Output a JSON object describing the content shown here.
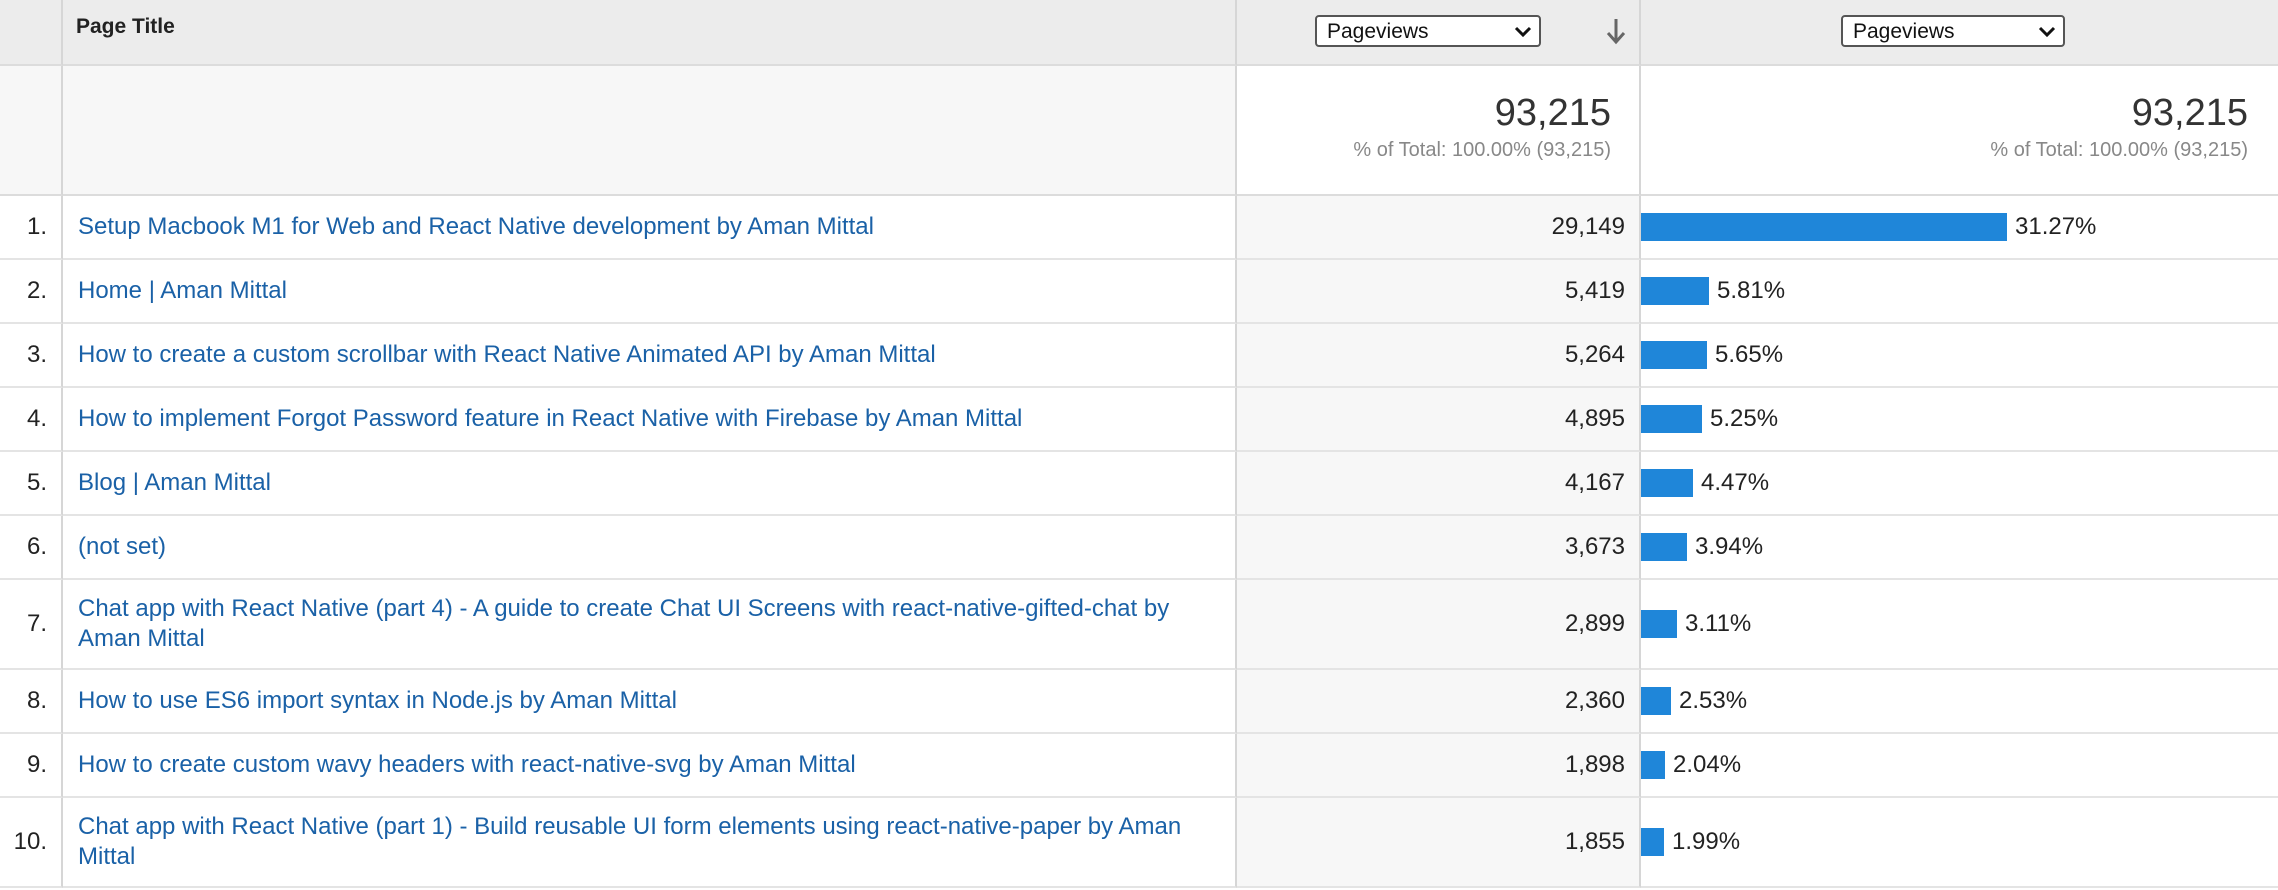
{
  "header": {
    "page_title_label": "Page Title",
    "metric_select_1": "Pageviews",
    "metric_select_2": "Pageviews",
    "sort_icon": "arrow-down-icon"
  },
  "totals": {
    "value": "93,215",
    "percent_label": "% of Total: 100.00% (93,215)",
    "value_2": "93,215",
    "percent_label_2": "% of Total: 100.00% (93,215)"
  },
  "colors": {
    "link": "#1a61a7",
    "bar": "#1f86d9",
    "header_bg": "#ececec"
  },
  "rows": [
    {
      "index": "1.",
      "title": "Setup Macbook M1 for Web and React Native development by Aman Mittal",
      "value": "29,149",
      "percent": "31.27%",
      "share": 31.27
    },
    {
      "index": "2.",
      "title": "Home | Aman Mittal",
      "value": "5,419",
      "percent": "5.81%",
      "share": 5.81
    },
    {
      "index": "3.",
      "title": "How to create a custom scrollbar with React Native Animated API by Aman Mittal",
      "value": "5,264",
      "percent": "5.65%",
      "share": 5.65
    },
    {
      "index": "4.",
      "title": "How to implement Forgot Password feature in React Native with Firebase by Aman Mittal",
      "value": "4,895",
      "percent": "5.25%",
      "share": 5.25
    },
    {
      "index": "5.",
      "title": "Blog | Aman Mittal",
      "value": "4,167",
      "percent": "4.47%",
      "share": 4.47
    },
    {
      "index": "6.",
      "title": "(not set)",
      "value": "3,673",
      "percent": "3.94%",
      "share": 3.94
    },
    {
      "index": "7.",
      "title": "Chat app with React Native (part 4) - A guide to create Chat UI Screens with react-native-gifted-chat by Aman Mittal",
      "value": "2,899",
      "percent": "3.11%",
      "share": 3.11
    },
    {
      "index": "8.",
      "title": "How to use ES6 import syntax in Node.js by Aman Mittal",
      "value": "2,360",
      "percent": "2.53%",
      "share": 2.53
    },
    {
      "index": "9.",
      "title": "How to create custom wavy headers with react-native-svg by Aman Mittal",
      "value": "1,898",
      "percent": "2.04%",
      "share": 2.04
    },
    {
      "index": "10.",
      "title": "Chat app with React Native (part 1) - Build reusable UI form elements using react-native-paper by Aman Mittal",
      "value": "1,855",
      "percent": "1.99%",
      "share": 1.99
    }
  ]
}
